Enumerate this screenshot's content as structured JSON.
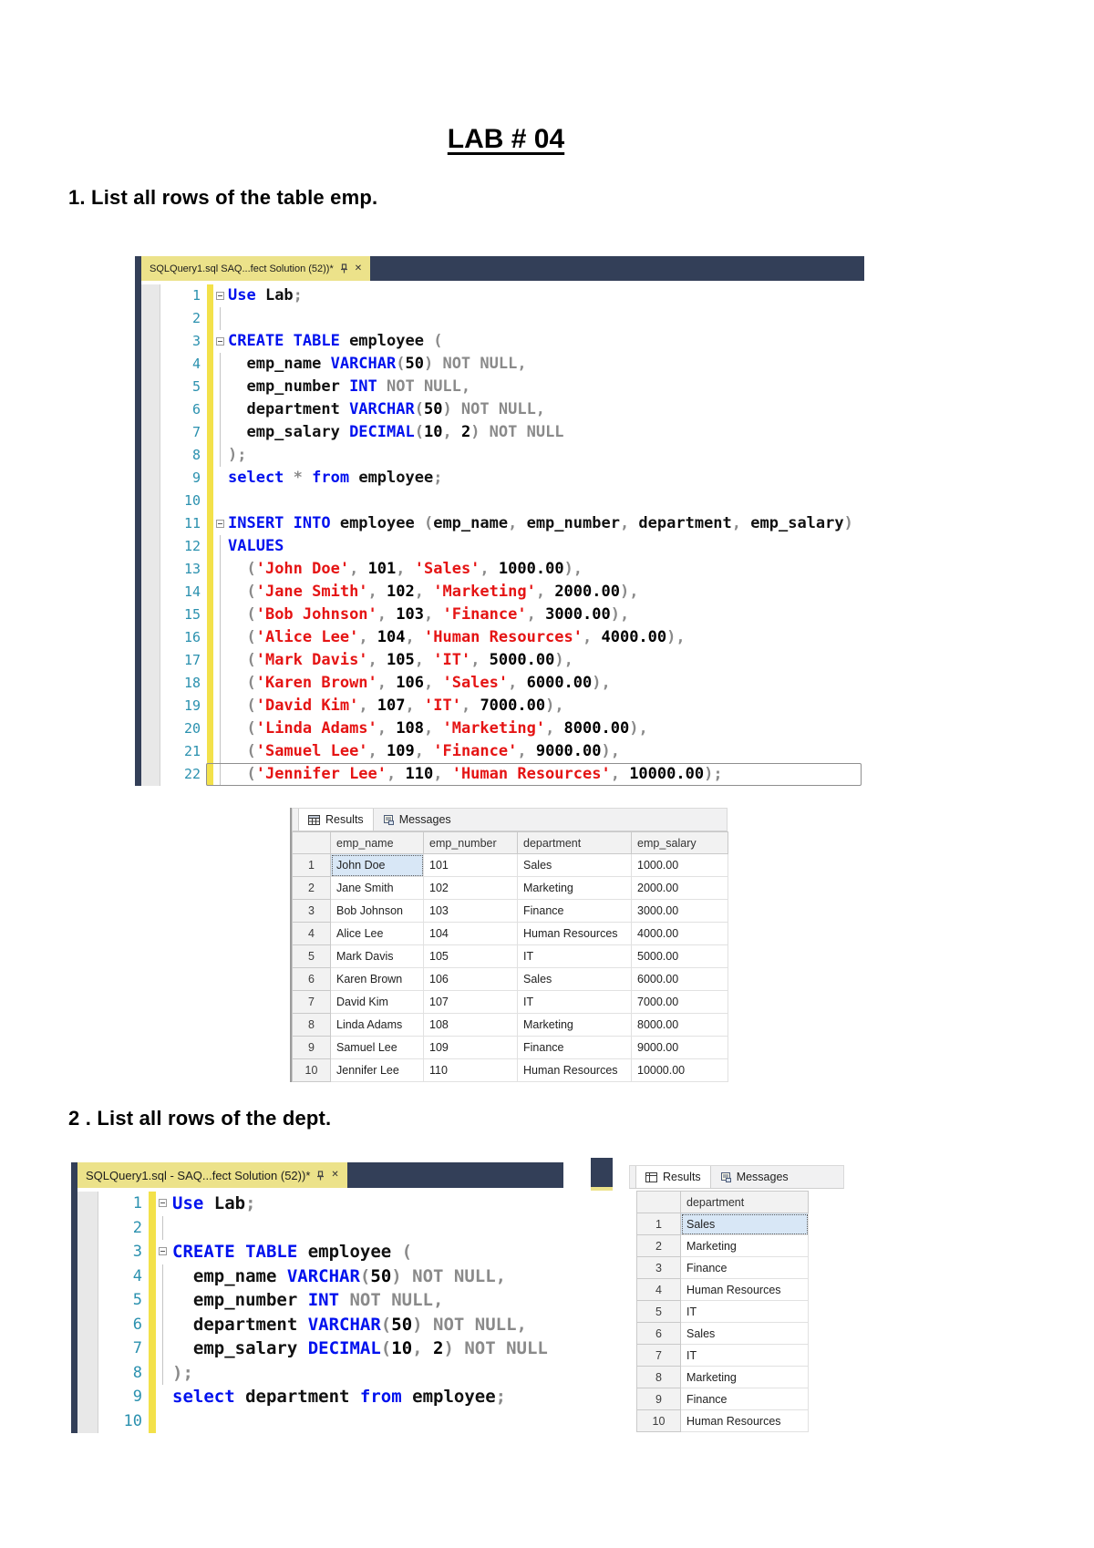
{
  "page": {
    "title": "LAB # 04",
    "q1": "1. List all rows of the table emp.",
    "q2": "2 . List all rows of the dept."
  },
  "icons": {
    "results_tab": "grid-icon",
    "messages_tab": "messages-icon",
    "tab_pin": "pin-icon",
    "tab_close": "close-icon",
    "close_glyph": "✕"
  },
  "editor1": {
    "tab": "SQLQuery1.sql  SAQ...fect Solution (52))*",
    "lines": [
      {
        "n": 1,
        "f": true,
        "t": [
          [
            "kw",
            "Use"
          ],
          [
            "pl",
            " Lab"
          ],
          [
            "gy",
            ";"
          ]
        ]
      },
      {
        "n": 2,
        "g": true,
        "t": []
      },
      {
        "n": 3,
        "f": true,
        "t": [
          [
            "kw",
            "CREATE TABLE"
          ],
          [
            "pl",
            " employee "
          ],
          [
            "gy",
            "("
          ]
        ]
      },
      {
        "n": 4,
        "g": true,
        "t": [
          [
            "pl",
            "  emp_name "
          ],
          [
            "kw",
            "VARCHAR"
          ],
          [
            "gy",
            "("
          ],
          [
            "nm",
            "50"
          ],
          [
            "gy",
            ") NOT NULL,"
          ]
        ]
      },
      {
        "n": 5,
        "g": true,
        "t": [
          [
            "pl",
            "  emp_number "
          ],
          [
            "kw",
            "INT"
          ],
          [
            "gy",
            " NOT NULL,"
          ]
        ]
      },
      {
        "n": 6,
        "g": true,
        "t": [
          [
            "pl",
            "  department "
          ],
          [
            "kw",
            "VARCHAR"
          ],
          [
            "gy",
            "("
          ],
          [
            "nm",
            "50"
          ],
          [
            "gy",
            ") NOT NULL,"
          ]
        ]
      },
      {
        "n": 7,
        "g": true,
        "t": [
          [
            "pl",
            "  emp_salary "
          ],
          [
            "kw",
            "DECIMAL"
          ],
          [
            "gy",
            "("
          ],
          [
            "nm",
            "10"
          ],
          [
            "gy",
            ", "
          ],
          [
            "nm",
            "2"
          ],
          [
            "gy",
            ") NOT NULL"
          ]
        ]
      },
      {
        "n": 8,
        "g": true,
        "t": [
          [
            "gy",
            ");"
          ]
        ]
      },
      {
        "n": 9,
        "t": [
          [
            "kw",
            "select"
          ],
          [
            "gy",
            " * "
          ],
          [
            "kw",
            "from"
          ],
          [
            "pl",
            " employee"
          ],
          [
            "gy",
            ";"
          ]
        ]
      },
      {
        "n": 10,
        "t": []
      },
      {
        "n": 11,
        "f": true,
        "t": [
          [
            "kw",
            "INSERT INTO"
          ],
          [
            "pl",
            " employee "
          ],
          [
            "gy",
            "("
          ],
          [
            "pl",
            "emp_name"
          ],
          [
            "gy",
            ", "
          ],
          [
            "pl",
            "emp_number"
          ],
          [
            "gy",
            ", "
          ],
          [
            "pl",
            "department"
          ],
          [
            "gy",
            ", "
          ],
          [
            "pl",
            "emp_salary"
          ],
          [
            "gy",
            ")"
          ]
        ]
      },
      {
        "n": 12,
        "g": true,
        "t": [
          [
            "kw",
            "VALUES"
          ]
        ]
      },
      {
        "n": 13,
        "g": true,
        "t": [
          [
            "gy",
            "  ("
          ],
          [
            "st",
            "'John Doe'"
          ],
          [
            "gy",
            ", "
          ],
          [
            "nm",
            "101"
          ],
          [
            "gy",
            ", "
          ],
          [
            "st",
            "'Sales'"
          ],
          [
            "gy",
            ", "
          ],
          [
            "nm",
            "1000.00"
          ],
          [
            "gy",
            "),"
          ]
        ]
      },
      {
        "n": 14,
        "g": true,
        "t": [
          [
            "gy",
            "  ("
          ],
          [
            "st",
            "'Jane Smith'"
          ],
          [
            "gy",
            ", "
          ],
          [
            "nm",
            "102"
          ],
          [
            "gy",
            ", "
          ],
          [
            "st",
            "'Marketing'"
          ],
          [
            "gy",
            ", "
          ],
          [
            "nm",
            "2000.00"
          ],
          [
            "gy",
            "),"
          ]
        ]
      },
      {
        "n": 15,
        "g": true,
        "t": [
          [
            "gy",
            "  ("
          ],
          [
            "st",
            "'Bob Johnson'"
          ],
          [
            "gy",
            ", "
          ],
          [
            "nm",
            "103"
          ],
          [
            "gy",
            ", "
          ],
          [
            "st",
            "'Finance'"
          ],
          [
            "gy",
            ", "
          ],
          [
            "nm",
            "3000.00"
          ],
          [
            "gy",
            "),"
          ]
        ]
      },
      {
        "n": 16,
        "g": true,
        "t": [
          [
            "gy",
            "  ("
          ],
          [
            "st",
            "'Alice Lee'"
          ],
          [
            "gy",
            ", "
          ],
          [
            "nm",
            "104"
          ],
          [
            "gy",
            ", "
          ],
          [
            "st",
            "'Human Resources'"
          ],
          [
            "gy",
            ", "
          ],
          [
            "nm",
            "4000.00"
          ],
          [
            "gy",
            "),"
          ]
        ]
      },
      {
        "n": 17,
        "g": true,
        "t": [
          [
            "gy",
            "  ("
          ],
          [
            "st",
            "'Mark Davis'"
          ],
          [
            "gy",
            ", "
          ],
          [
            "nm",
            "105"
          ],
          [
            "gy",
            ", "
          ],
          [
            "st",
            "'IT'"
          ],
          [
            "gy",
            ", "
          ],
          [
            "nm",
            "5000.00"
          ],
          [
            "gy",
            "),"
          ]
        ]
      },
      {
        "n": 18,
        "g": true,
        "t": [
          [
            "gy",
            "  ("
          ],
          [
            "st",
            "'Karen Brown'"
          ],
          [
            "gy",
            ", "
          ],
          [
            "nm",
            "106"
          ],
          [
            "gy",
            ", "
          ],
          [
            "st",
            "'Sales'"
          ],
          [
            "gy",
            ", "
          ],
          [
            "nm",
            "6000.00"
          ],
          [
            "gy",
            "),"
          ]
        ]
      },
      {
        "n": 19,
        "g": true,
        "t": [
          [
            "gy",
            "  ("
          ],
          [
            "st",
            "'David Kim'"
          ],
          [
            "gy",
            ", "
          ],
          [
            "nm",
            "107"
          ],
          [
            "gy",
            ", "
          ],
          [
            "st",
            "'IT'"
          ],
          [
            "gy",
            ", "
          ],
          [
            "nm",
            "7000.00"
          ],
          [
            "gy",
            "),"
          ]
        ]
      },
      {
        "n": 20,
        "g": true,
        "t": [
          [
            "gy",
            "  ("
          ],
          [
            "st",
            "'Linda Adams'"
          ],
          [
            "gy",
            ", "
          ],
          [
            "nm",
            "108"
          ],
          [
            "gy",
            ", "
          ],
          [
            "st",
            "'Marketing'"
          ],
          [
            "gy",
            ", "
          ],
          [
            "nm",
            "8000.00"
          ],
          [
            "gy",
            "),"
          ]
        ]
      },
      {
        "n": 21,
        "g": true,
        "t": [
          [
            "gy",
            "  ("
          ],
          [
            "st",
            "'Samuel Lee'"
          ],
          [
            "gy",
            ", "
          ],
          [
            "nm",
            "109"
          ],
          [
            "gy",
            ", "
          ],
          [
            "st",
            "'Finance'"
          ],
          [
            "gy",
            ", "
          ],
          [
            "nm",
            "9000.00"
          ],
          [
            "gy",
            "),"
          ]
        ]
      },
      {
        "n": 22,
        "g": true,
        "box": true,
        "t": [
          [
            "gy",
            "  ("
          ],
          [
            "st",
            "'Jennifer Lee'"
          ],
          [
            "gy",
            ", "
          ],
          [
            "nm",
            "110"
          ],
          [
            "gy",
            ", "
          ],
          [
            "st",
            "'Human Resources'"
          ],
          [
            "gy",
            ", "
          ],
          [
            "nm",
            "10000.00"
          ],
          [
            "gy",
            ");"
          ]
        ]
      }
    ]
  },
  "results1": {
    "tabs": {
      "results": "Results",
      "messages": "Messages"
    },
    "columns": [
      "emp_name",
      "emp_number",
      "department",
      "emp_salary"
    ],
    "rows": [
      [
        "1",
        "John Doe",
        "101",
        "Sales",
        "1000.00"
      ],
      [
        "2",
        "Jane Smith",
        "102",
        "Marketing",
        "2000.00"
      ],
      [
        "3",
        "Bob Johnson",
        "103",
        "Finance",
        "3000.00"
      ],
      [
        "4",
        "Alice Lee",
        "104",
        "Human Resources",
        "4000.00"
      ],
      [
        "5",
        "Mark Davis",
        "105",
        "IT",
        "5000.00"
      ],
      [
        "6",
        "Karen Brown",
        "106",
        "Sales",
        "6000.00"
      ],
      [
        "7",
        "David Kim",
        "107",
        "IT",
        "7000.00"
      ],
      [
        "8",
        "Linda Adams",
        "108",
        "Marketing",
        "8000.00"
      ],
      [
        "9",
        "Samuel Lee",
        "109",
        "Finance",
        "9000.00"
      ],
      [
        "10",
        "Jennifer Lee",
        "110",
        "Human Resources",
        "10000.00"
      ]
    ]
  },
  "editor2": {
    "tab": "SQLQuery1.sql - SAQ...fect Solution (52))*",
    "lines": [
      {
        "n": 1,
        "f": true,
        "t": [
          [
            "kw",
            "Use"
          ],
          [
            "pl",
            " Lab"
          ],
          [
            "gy",
            ";"
          ]
        ]
      },
      {
        "n": 2,
        "g": true,
        "t": []
      },
      {
        "n": 3,
        "f": true,
        "t": [
          [
            "kw",
            "CREATE TABLE"
          ],
          [
            "pl",
            " employee "
          ],
          [
            "gy",
            "("
          ]
        ]
      },
      {
        "n": 4,
        "g": true,
        "t": [
          [
            "pl",
            "  emp_name "
          ],
          [
            "kw",
            "VARCHAR"
          ],
          [
            "gy",
            "("
          ],
          [
            "nm",
            "50"
          ],
          [
            "gy",
            ") NOT NULL,"
          ]
        ]
      },
      {
        "n": 5,
        "g": true,
        "t": [
          [
            "pl",
            "  emp_number "
          ],
          [
            "kw",
            "INT"
          ],
          [
            "gy",
            " NOT NULL,"
          ]
        ]
      },
      {
        "n": 6,
        "g": true,
        "t": [
          [
            "pl",
            "  department "
          ],
          [
            "kw",
            "VARCHAR"
          ],
          [
            "gy",
            "("
          ],
          [
            "nm",
            "50"
          ],
          [
            "gy",
            ") NOT NULL,"
          ]
        ]
      },
      {
        "n": 7,
        "g": true,
        "t": [
          [
            "pl",
            "  emp_salary "
          ],
          [
            "kw",
            "DECIMAL"
          ],
          [
            "gy",
            "("
          ],
          [
            "nm",
            "10"
          ],
          [
            "gy",
            ", "
          ],
          [
            "nm",
            "2"
          ],
          [
            "gy",
            ") NOT NULL"
          ]
        ]
      },
      {
        "n": 8,
        "g": true,
        "t": [
          [
            "gy",
            ");"
          ]
        ]
      },
      {
        "n": 9,
        "t": [
          [
            "kw",
            "select"
          ],
          [
            "pl",
            " department "
          ],
          [
            "kw",
            "from"
          ],
          [
            "pl",
            " employee"
          ],
          [
            "gy",
            ";"
          ]
        ]
      },
      {
        "n": 10,
        "t": []
      }
    ]
  },
  "results2": {
    "tabs": {
      "results": "Results",
      "messages": "Messages"
    },
    "columns": [
      "department"
    ],
    "rows": [
      [
        "1",
        "Sales"
      ],
      [
        "2",
        "Marketing"
      ],
      [
        "3",
        "Finance"
      ],
      [
        "4",
        "Human Resources"
      ],
      [
        "5",
        "IT"
      ],
      [
        "6",
        "Sales"
      ],
      [
        "7",
        "IT"
      ],
      [
        "8",
        "Marketing"
      ],
      [
        "9",
        "Finance"
      ],
      [
        "10",
        "Human Resources"
      ]
    ]
  }
}
